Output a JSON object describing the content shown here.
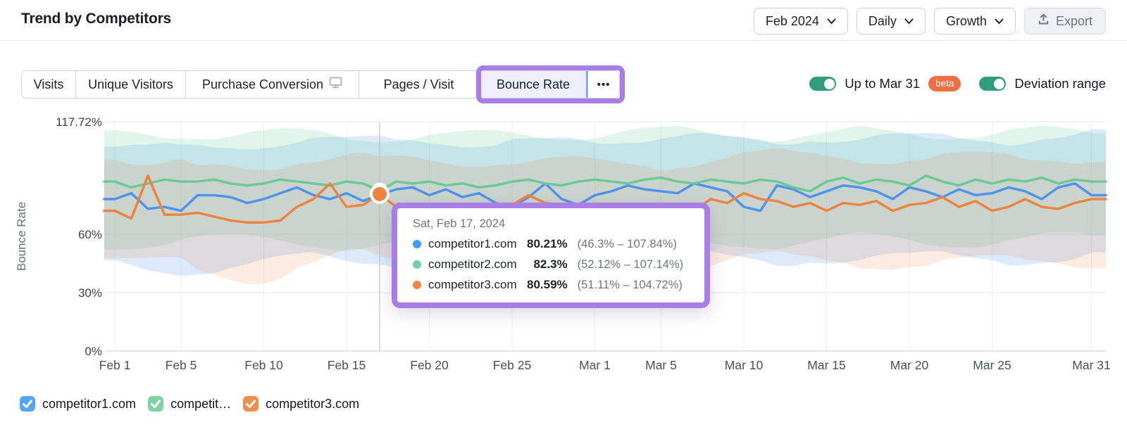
{
  "header": {
    "title": "Trend by Competitors",
    "date_filter": "Feb 2024",
    "granularity_filter": "Daily",
    "mode_filter": "Growth",
    "export_label": "Export"
  },
  "tabs": {
    "items": [
      "Visits",
      "Unique Visitors",
      "Purchase Conversion",
      "Pages / Visit",
      "Bounce Rate"
    ],
    "active": "Bounce Rate",
    "more": "•••"
  },
  "toggles": {
    "up_to": {
      "label": "Up to Mar 31",
      "badge": "beta",
      "on": true
    },
    "deviation": {
      "label": "Deviation range",
      "on": true
    }
  },
  "tooltip": {
    "date": "Sat, Feb 17, 2024",
    "rows": [
      {
        "name": "competitor1.com",
        "value": "80.21%",
        "range": "(46.3% – 107.84%)",
        "color": "#3f9ef2"
      },
      {
        "name": "competitor2.com",
        "value": "82.3%",
        "range": "(52.12% – 107.14%)",
        "color": "#72d09f"
      },
      {
        "name": "competitor3.com",
        "value": "80.59%",
        "range": "(51.11% – 104.72%)",
        "color": "#ee8647"
      }
    ]
  },
  "legend": [
    {
      "label": "competitor1.com",
      "color": "#56a5f2",
      "checked": true
    },
    {
      "label": "competit…",
      "color": "#7ed3a2",
      "checked": true
    },
    {
      "label": "competitor3.com",
      "color": "#ef8f4d",
      "checked": true
    }
  ],
  "chart_data": {
    "type": "line",
    "ylabel": "Bounce Rate",
    "ylim": [
      0,
      117.72
    ],
    "grid": true,
    "deviation_range_shown": true,
    "yticks": [
      {
        "value": 117.72,
        "label": "117.72%"
      },
      {
        "value": 60,
        "label": "60%"
      },
      {
        "value": 30,
        "label": "30%"
      },
      {
        "value": 0,
        "label": "0%"
      }
    ],
    "xticks": [
      {
        "day": 0,
        "label": "Feb 1"
      },
      {
        "day": 4,
        "label": "Feb 5"
      },
      {
        "day": 9,
        "label": "Feb 10"
      },
      {
        "day": 14,
        "label": "Feb 15"
      },
      {
        "day": 19,
        "label": "Feb 20"
      },
      {
        "day": 24,
        "label": "Feb 25"
      },
      {
        "day": 29,
        "label": "Mar 1"
      },
      {
        "day": 33,
        "label": "Mar 5"
      },
      {
        "day": 38,
        "label": "Mar 10"
      },
      {
        "day": 43,
        "label": "Mar 15"
      },
      {
        "day": 48,
        "label": "Mar 20"
      },
      {
        "day": 53,
        "label": "Mar 25"
      },
      {
        "day": 59,
        "label": "Mar 31"
      }
    ],
    "n_days": 60,
    "highlight_day": 16,
    "highlight_date": "Sat, Feb 17, 2024",
    "series": [
      {
        "name": "competitor1.com",
        "color": "#5093ec",
        "band_color": "rgba(82,149,238,0.20)",
        "band_up": 27.6,
        "band_down": 33.9,
        "values": [
          78,
          81,
          73,
          74,
          72,
          80,
          80,
          79,
          76,
          78,
          81,
          84,
          80,
          78,
          81,
          77,
          80.21,
          83,
          84,
          80,
          83,
          79,
          81,
          76,
          74,
          79,
          86,
          78,
          75,
          80,
          82,
          85,
          83,
          82,
          81,
          86,
          84,
          82,
          74,
          72,
          85,
          83,
          79,
          82,
          85,
          84,
          82,
          78,
          84,
          82,
          79,
          83,
          80,
          81,
          84,
          82,
          78,
          84,
          86,
          80
        ]
      },
      {
        "name": "competitor2.com",
        "color": "#69c998",
        "band_color": "rgba(104,203,150,0.20)",
        "band_up": 24.8,
        "band_down": 30.2,
        "values": [
          87,
          84,
          86,
          88,
          87,
          87,
          88,
          86,
          85,
          86,
          88,
          87,
          86,
          85,
          87,
          86,
          82.3,
          87,
          86,
          87,
          85,
          86,
          84,
          85,
          87,
          88,
          86,
          85,
          87,
          88,
          87,
          86,
          88,
          89,
          87,
          86,
          88,
          87,
          86,
          88,
          87,
          84,
          82,
          87,
          89,
          86,
          88,
          87,
          85,
          90,
          87,
          85,
          88,
          86,
          88,
          87,
          89,
          86,
          88,
          87
        ]
      },
      {
        "name": "competitor3.com",
        "color": "#ec8440",
        "band_color": "rgba(236,132,64,0.16)",
        "band_up": 24.1,
        "band_down": 29.5,
        "values": [
          72,
          68,
          90,
          70,
          70,
          71,
          69,
          67,
          66,
          66,
          67,
          74,
          78,
          86,
          74,
          75,
          80.59,
          74,
          70,
          68,
          70,
          73,
          72,
          71,
          75,
          80,
          76,
          75,
          74,
          70,
          74,
          66,
          68,
          71,
          72,
          72,
          78,
          76,
          81,
          78,
          77,
          74,
          76,
          72,
          76,
          75,
          77,
          72,
          75,
          76,
          79,
          74,
          77,
          72,
          74,
          78,
          74,
          73,
          76,
          78
        ]
      }
    ]
  }
}
